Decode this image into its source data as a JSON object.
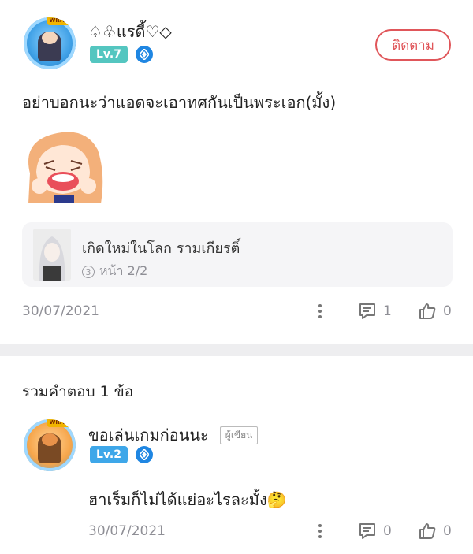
{
  "post": {
    "author_name": "♤♧แรดี้♡◇",
    "level": "Lv.7",
    "follow_label": "ติดตาม",
    "text": "อย่าบอกนะว่าแอดจะเอาทศกันเป็นพระเอก(มั้ง)",
    "novel": {
      "title": "เกิดใหม่ในโลก รามเกียรติ์",
      "page": "หน้า 2/2"
    },
    "date": "30/07/2021",
    "reply_count": "1",
    "like_count": "0",
    "avatar_banner": "WRITER"
  },
  "replies_header": "รวมคำตอบ 1 ข้อ",
  "reply": {
    "author_name": "ขอเล่นเกมก่อนนะ",
    "author_tag": "ผู้เขียน",
    "level": "Lv.2",
    "text": "ฮาเร็มก็ไม่ได้แย่อะไรละมั้ง🤔",
    "date": "30/07/2021",
    "reply_count": "0",
    "like_count": "0",
    "avatar_banner": "WRITER"
  },
  "colors": {
    "accent": "#e0565a",
    "level_teal": "#54c6c0",
    "level_blue": "#3ea7e9",
    "verified_blue": "#1f86e2"
  },
  "icons": {
    "verified": "diamond-verified-icon",
    "more": "vertical-dots-icon",
    "comment": "speech-bubble-icon",
    "like": "thumbs-up-icon"
  }
}
